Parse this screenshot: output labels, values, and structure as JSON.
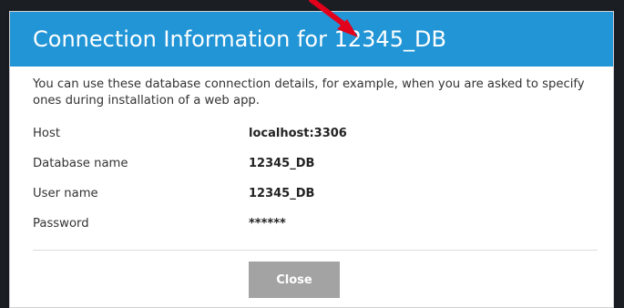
{
  "dialog": {
    "title": "Connection Information for 12345_DB",
    "description": "You can use these database connection details, for example, when you are asked to specify ones during installation of a web app.",
    "details": [
      {
        "label": "Host",
        "value": "localhost:3306"
      },
      {
        "label": "Database name",
        "value": "12345_DB"
      },
      {
        "label": "User name",
        "value": "12345_DB"
      },
      {
        "label": "Password",
        "value": "******"
      }
    ],
    "close_label": "Close"
  },
  "colors": {
    "header_background": "#2295d6",
    "close_button_background": "#a3a3a3",
    "annotation_arrow": "#e3001b"
  }
}
